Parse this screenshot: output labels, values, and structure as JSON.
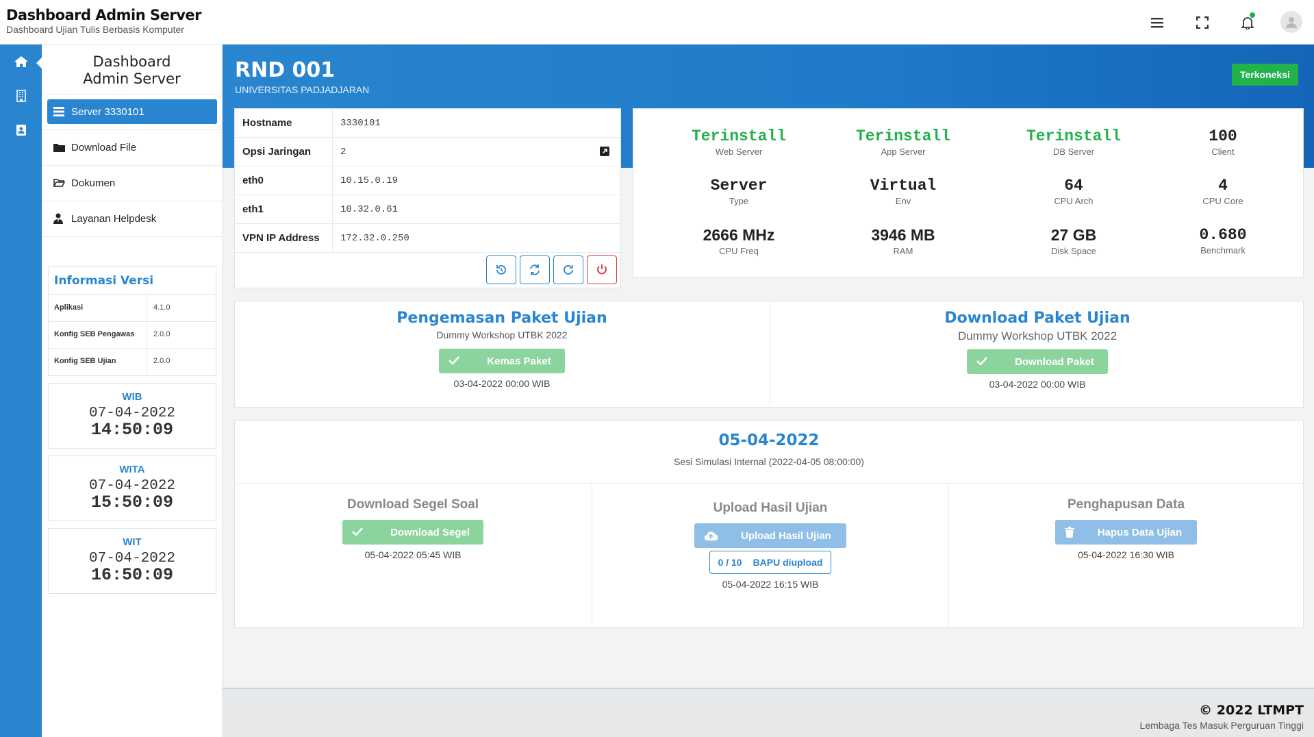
{
  "header": {
    "title": "Dashboard Admin Server",
    "subtitle": "Dashboard Ujian Tulis Berbasis Komputer"
  },
  "sidebar": {
    "title": "Dashboard Admin Server",
    "items": [
      {
        "label": "Server 3330101",
        "icon": "list-icon",
        "active": true
      },
      {
        "label": "Download File",
        "icon": "folder-icon"
      },
      {
        "label": "Dokumen",
        "icon": "folder-open-icon"
      },
      {
        "label": "Layanan Helpdesk",
        "icon": "user-tie-icon"
      }
    ]
  },
  "version_info": {
    "title": "Informasi Versi",
    "rows": [
      {
        "key": "Aplikasi",
        "value": "4.1.0"
      },
      {
        "key": "Konfig SEB Pengawas",
        "value": "2.0.0"
      },
      {
        "key": "Konfig SEB Ujian",
        "value": "2.0.0"
      }
    ]
  },
  "clocks": [
    {
      "tz": "WIB",
      "date": "07-04-2022",
      "time": "14:50:09"
    },
    {
      "tz": "WITA",
      "date": "07-04-2022",
      "time": "15:50:09"
    },
    {
      "tz": "WIT",
      "date": "07-04-2022",
      "time": "16:50:09"
    }
  ],
  "server": {
    "name": "RND 001",
    "org": "UNIVERSITAS PADJADJARAN",
    "status": "Terkoneksi"
  },
  "info_table": [
    {
      "key": "Hostname",
      "value": "3330101"
    },
    {
      "key": "Opsi Jaringan",
      "value": "2"
    },
    {
      "key": "eth0",
      "value": "10.15.0.19"
    },
    {
      "key": "eth1",
      "value": "10.32.0.61"
    },
    {
      "key": "VPN IP Address",
      "value": "172.32.0.250"
    }
  ],
  "stats": [
    {
      "value": "Terinstall",
      "label": "Web Server",
      "highlight": true
    },
    {
      "value": "Terinstall",
      "label": "App Server",
      "highlight": true
    },
    {
      "value": "Terinstall",
      "label": "DB Server",
      "highlight": true
    },
    {
      "value": "100",
      "label": "Client"
    },
    {
      "value": "Server",
      "label": "Type"
    },
    {
      "value": "Virtual",
      "label": "Env"
    },
    {
      "value": "64",
      "label": "CPU Arch"
    },
    {
      "value": "4",
      "label": "CPU Core"
    },
    {
      "value": "2666 MHz",
      "label": "CPU Freq"
    },
    {
      "value": "3946 MB",
      "label": "RAM"
    },
    {
      "value": "27 GB",
      "label": "Disk Space"
    },
    {
      "value": "0.680",
      "label": "Benchmark"
    }
  ],
  "paket": {
    "pengemasan": {
      "title": "Pengemasan Paket Ujian",
      "sub": "Dummy Workshop UTBK 2022",
      "button": "Kemas Paket",
      "date": "03-04-2022 00:00 WIB"
    },
    "download": {
      "title": "Download Paket Ujian",
      "sub": "Dummy Workshop UTBK 2022",
      "button": "Download Paket",
      "date": "03-04-2022 00:00 WIB"
    }
  },
  "session": {
    "date": "05-04-2022",
    "sub": "Sesi Simulasi Internal (2022-04-05 08:00:00)",
    "segel": {
      "title": "Download Segel Soal",
      "button": "Download Segel",
      "date": "05-04-2022 05:45 WIB"
    },
    "upload": {
      "title": "Upload Hasil Ujian",
      "button": "Upload Hasil Ujian",
      "bapu_count": "0 / 10",
      "bapu_label": "BAPU diupload",
      "date": "05-04-2022 16:15 WIB"
    },
    "hapus": {
      "title": "Penghapusan Data",
      "button": "Hapus Data Ujian",
      "date": "05-04-2022 16:30 WIB"
    }
  },
  "footer": {
    "title": "© 2022 LTMPT",
    "subtitle": "Lembaga Tes Masuk Perguruan Tinggi"
  },
  "colors": {
    "primary": "#2a85d0",
    "success": "#22b14c",
    "danger": "#d9393b"
  }
}
